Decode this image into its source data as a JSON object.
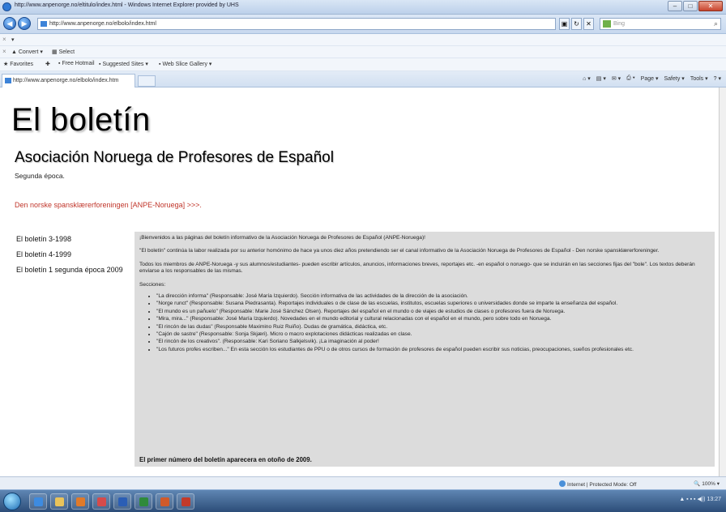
{
  "window": {
    "title": "http://www.anpenorge.no/eltitulo/index.html - Windows Internet Explorer provided by UHS"
  },
  "address_bar": {
    "url": "http://www.anpenorge.no/elbolo/index.html",
    "search_placeholder": "Bing"
  },
  "toolbar": {
    "convert_label": "Convert",
    "select_label": "Select",
    "favorites_label": "Favorites",
    "free_hotmail_label": "Free Hotmail",
    "suggested_sites_label": "Suggested Sites",
    "web_slice_gallery_label": "Web Slice Gallery"
  },
  "tab": {
    "label": "http://www.anpenorge.no/elbolo/index.htm"
  },
  "command_bar": {
    "page_label": "Page",
    "safety_label": "Safety",
    "tools_label": "Tools"
  },
  "page": {
    "title": "El boletín",
    "subtitle": "Asociación Noruega de Profesores de Español",
    "epoch": "Segunda época.",
    "norwegian_link": "Den norske spansklærerforeningen [ANPE-Noruega] >>>.",
    "sidebar": [
      {
        "label": "El boletín 3-1998"
      },
      {
        "label": "El boletín 4-1999"
      },
      {
        "label": "El boletín 1 segunda época 2009"
      }
    ],
    "welcome": "¡Bienvenidos a las páginas del boletín informativo de la Asociación Noruega de Profesores de Español (ANPE-Noruega)!",
    "intro": "\"El boletín\" continúa la labor realizada por su anterior homónimo de hace ya unos diez años pretendiendo ser el canal informativo de la Asociación Noruega de Profesores de Español - Den norske spansklærerforeninger.",
    "members": "Todos los miembros de ANPE-Noruega -y sus alumnos/estudiantes- pueden escribir artículos, anuncios, informaciones breves, reportajes etc. -en español o noruego- que se incluirán en las secciones fijas del \"bole\". Los textos deberán enviarse a los responsables de las mismas.",
    "sections_heading": "Secciones:",
    "sections": [
      "\"La dirección informa\" (Responsable: José María Izquierdo). Sección informativa de las actividades de la dirección de la asociación.",
      "\"Norge runct\" (Responsable: Susana Piedrasanta). Reportajes individuales o de clase de las escuelas, institutos, escuelas superiores o universidades donde se imparte la enseñanza del español.",
      "\"El mundo es un pañuelo\" (Responsable: Marie José Sánchez Olsen). Reportajes del español en el mundo o de viajes de estudios de clases o profesores fuera de Noruega.",
      "\"Mira, mira...\" (Responsable: José María Izquierdo). Novedades en el mundo editorial y cultural relacionadas con el español en el mundo, pero sobre todo en Noruega.",
      "\"El rincón de las dudas\" (Responsable Maximino Ruiz Ruiño). Dudas de gramática, didáctica, etc.",
      "\"Cajón de sastre\" (Responsable: Sonja Skjæri). Micro o macro explotaciones didácticas realizadas en clase.",
      "\"El rincón de los creativos\". (Responsable: Kari Soriano Salkjelsvik). ¡La imaginación al poder!",
      "\"Los futuros profes escriben...\" En esta sección los estudiantes de PPU o de otros cursos de formación de profesores de español pueden escribir sus noticias, preocupaciones, sueños profesionales etc."
    ],
    "closing": "El primer número del boletín aparecera en otoño de 2009."
  },
  "status_bar": {
    "zone": "Internet | Protected Mode: Off",
    "zoom": "100%"
  },
  "taskbar": {
    "clock": "13:27"
  },
  "colors": {
    "link_red": "#c0352a",
    "content_box": "#dcdcdc"
  }
}
